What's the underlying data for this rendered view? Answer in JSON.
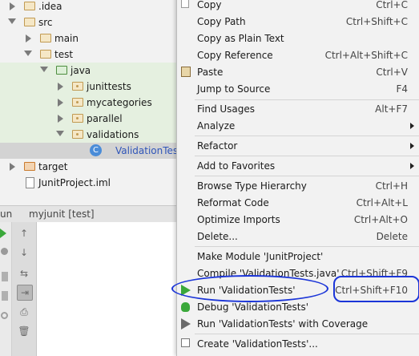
{
  "tree": [
    {
      "label": ".idea",
      "type": "folder"
    },
    {
      "label": "src",
      "type": "folder"
    },
    {
      "label": "main",
      "type": "folder"
    },
    {
      "label": "test",
      "type": "folder"
    },
    {
      "label": "java",
      "type": "source-folder"
    },
    {
      "label": "junittests",
      "type": "package"
    },
    {
      "label": "mycategories",
      "type": "package"
    },
    {
      "label": "parallel",
      "type": "package"
    },
    {
      "label": "validations",
      "type": "package"
    },
    {
      "label": "ValidationTests",
      "type": "class"
    },
    {
      "label": "target",
      "type": "folder"
    },
    {
      "label": "JunitProject.iml",
      "type": "file"
    }
  ],
  "run_panel": {
    "title": "un",
    "config": "myjunit [test]"
  },
  "menu": {
    "items": [
      {
        "label": "Copy",
        "shortcut": "Ctrl+C"
      },
      {
        "label": "Copy Path",
        "shortcut": "Ctrl+Shift+C"
      },
      {
        "label": "Copy as Plain Text",
        "shortcut": ""
      },
      {
        "label": "Copy Reference",
        "shortcut": "Ctrl+Alt+Shift+C"
      },
      {
        "label": "Paste",
        "shortcut": "Ctrl+V"
      },
      {
        "label": "Jump to Source",
        "shortcut": "F4"
      },
      {
        "label": "Find Usages",
        "shortcut": "Alt+F7"
      },
      {
        "label": "Analyze",
        "shortcut": ""
      },
      {
        "label": "Refactor",
        "shortcut": ""
      },
      {
        "label": "Add to Favorites",
        "shortcut": ""
      },
      {
        "label": "Browse Type Hierarchy",
        "shortcut": "Ctrl+H"
      },
      {
        "label": "Reformat Code",
        "shortcut": "Ctrl+Alt+L"
      },
      {
        "label": "Optimize Imports",
        "shortcut": "Ctrl+Alt+O"
      },
      {
        "label": "Delete...",
        "shortcut": "Delete"
      },
      {
        "label": "Make Module 'JunitProject'",
        "shortcut": ""
      },
      {
        "label": "Compile 'ValidationTests.java'",
        "shortcut": "Ctrl+Shift+F9"
      },
      {
        "label": "Run 'ValidationTests'",
        "shortcut": "Ctrl+Shift+F10"
      },
      {
        "label": "Debug 'ValidationTests'",
        "shortcut": ""
      },
      {
        "label": "Run 'ValidationTests' with Coverage",
        "shortcut": ""
      },
      {
        "label": "Create 'ValidationTests'...",
        "shortcut": ""
      }
    ]
  },
  "colors": {
    "annotation": "#1b35d8",
    "run_green": "#3aa83a",
    "menu_bg": "#f2f2f2"
  }
}
